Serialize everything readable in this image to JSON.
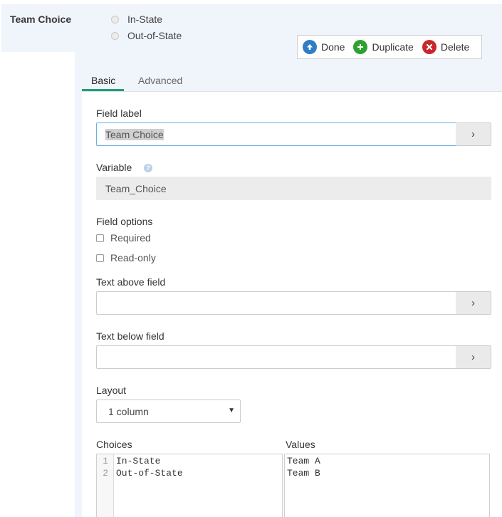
{
  "preview": {
    "title": "Team Choice",
    "radio_options": [
      "In-State",
      "Out-of-State"
    ]
  },
  "toolbar": {
    "done_label": "Done",
    "duplicate_label": "Duplicate",
    "delete_label": "Delete"
  },
  "tabs": [
    {
      "label": "Basic",
      "active": true
    },
    {
      "label": "Advanced",
      "active": false
    }
  ],
  "form": {
    "field_label": {
      "label": "Field label",
      "value": "Team Choice"
    },
    "variable": {
      "label": "Variable",
      "value": "Team_Choice"
    },
    "field_options": {
      "label": "Field options",
      "required": "Required",
      "read_only": "Read-only"
    },
    "text_above": {
      "label": "Text above field",
      "value": ""
    },
    "text_below": {
      "label": "Text below field",
      "value": ""
    },
    "layout": {
      "label": "Layout",
      "selected": "1 column"
    },
    "choices": {
      "label": "Choices",
      "lines": [
        "In-State",
        "Out-of-State"
      ],
      "line_numbers": [
        "1",
        "2"
      ]
    },
    "values": {
      "label": "Values",
      "lines": [
        "Team A",
        "Team B"
      ]
    }
  },
  "icons": {
    "done": "arrow-up-circle-icon",
    "duplicate": "plus-circle-icon",
    "delete": "x-circle-icon",
    "side_button": "chevron-right-icon",
    "help": "question-icon"
  },
  "colors": {
    "accent_tab": "#1aa07a",
    "done_icon": "#2e7dc6",
    "duplicate_icon": "#2ea12e",
    "delete_icon": "#c9262b",
    "preview_bg": "#f0f4fb"
  }
}
